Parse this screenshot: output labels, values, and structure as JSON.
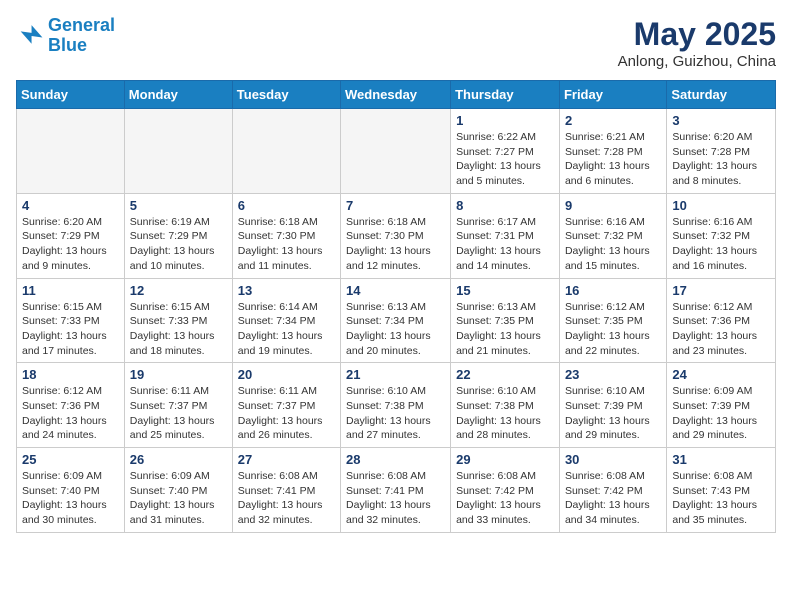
{
  "header": {
    "logo_line1": "General",
    "logo_line2": "Blue",
    "main_title": "May 2025",
    "sub_title": "Anlong, Guizhou, China"
  },
  "days_of_week": [
    "Sunday",
    "Monday",
    "Tuesday",
    "Wednesday",
    "Thursday",
    "Friday",
    "Saturday"
  ],
  "weeks": [
    [
      {
        "day": "",
        "info": ""
      },
      {
        "day": "",
        "info": ""
      },
      {
        "day": "",
        "info": ""
      },
      {
        "day": "",
        "info": ""
      },
      {
        "day": "1",
        "info": "Sunrise: 6:22 AM\nSunset: 7:27 PM\nDaylight: 13 hours and 5 minutes."
      },
      {
        "day": "2",
        "info": "Sunrise: 6:21 AM\nSunset: 7:28 PM\nDaylight: 13 hours and 6 minutes."
      },
      {
        "day": "3",
        "info": "Sunrise: 6:20 AM\nSunset: 7:28 PM\nDaylight: 13 hours and 8 minutes."
      }
    ],
    [
      {
        "day": "4",
        "info": "Sunrise: 6:20 AM\nSunset: 7:29 PM\nDaylight: 13 hours and 9 minutes."
      },
      {
        "day": "5",
        "info": "Sunrise: 6:19 AM\nSunset: 7:29 PM\nDaylight: 13 hours and 10 minutes."
      },
      {
        "day": "6",
        "info": "Sunrise: 6:18 AM\nSunset: 7:30 PM\nDaylight: 13 hours and 11 minutes."
      },
      {
        "day": "7",
        "info": "Sunrise: 6:18 AM\nSunset: 7:30 PM\nDaylight: 13 hours and 12 minutes."
      },
      {
        "day": "8",
        "info": "Sunrise: 6:17 AM\nSunset: 7:31 PM\nDaylight: 13 hours and 14 minutes."
      },
      {
        "day": "9",
        "info": "Sunrise: 6:16 AM\nSunset: 7:32 PM\nDaylight: 13 hours and 15 minutes."
      },
      {
        "day": "10",
        "info": "Sunrise: 6:16 AM\nSunset: 7:32 PM\nDaylight: 13 hours and 16 minutes."
      }
    ],
    [
      {
        "day": "11",
        "info": "Sunrise: 6:15 AM\nSunset: 7:33 PM\nDaylight: 13 hours and 17 minutes."
      },
      {
        "day": "12",
        "info": "Sunrise: 6:15 AM\nSunset: 7:33 PM\nDaylight: 13 hours and 18 minutes."
      },
      {
        "day": "13",
        "info": "Sunrise: 6:14 AM\nSunset: 7:34 PM\nDaylight: 13 hours and 19 minutes."
      },
      {
        "day": "14",
        "info": "Sunrise: 6:13 AM\nSunset: 7:34 PM\nDaylight: 13 hours and 20 minutes."
      },
      {
        "day": "15",
        "info": "Sunrise: 6:13 AM\nSunset: 7:35 PM\nDaylight: 13 hours and 21 minutes."
      },
      {
        "day": "16",
        "info": "Sunrise: 6:12 AM\nSunset: 7:35 PM\nDaylight: 13 hours and 22 minutes."
      },
      {
        "day": "17",
        "info": "Sunrise: 6:12 AM\nSunset: 7:36 PM\nDaylight: 13 hours and 23 minutes."
      }
    ],
    [
      {
        "day": "18",
        "info": "Sunrise: 6:12 AM\nSunset: 7:36 PM\nDaylight: 13 hours and 24 minutes."
      },
      {
        "day": "19",
        "info": "Sunrise: 6:11 AM\nSunset: 7:37 PM\nDaylight: 13 hours and 25 minutes."
      },
      {
        "day": "20",
        "info": "Sunrise: 6:11 AM\nSunset: 7:37 PM\nDaylight: 13 hours and 26 minutes."
      },
      {
        "day": "21",
        "info": "Sunrise: 6:10 AM\nSunset: 7:38 PM\nDaylight: 13 hours and 27 minutes."
      },
      {
        "day": "22",
        "info": "Sunrise: 6:10 AM\nSunset: 7:38 PM\nDaylight: 13 hours and 28 minutes."
      },
      {
        "day": "23",
        "info": "Sunrise: 6:10 AM\nSunset: 7:39 PM\nDaylight: 13 hours and 29 minutes."
      },
      {
        "day": "24",
        "info": "Sunrise: 6:09 AM\nSunset: 7:39 PM\nDaylight: 13 hours and 29 minutes."
      }
    ],
    [
      {
        "day": "25",
        "info": "Sunrise: 6:09 AM\nSunset: 7:40 PM\nDaylight: 13 hours and 30 minutes."
      },
      {
        "day": "26",
        "info": "Sunrise: 6:09 AM\nSunset: 7:40 PM\nDaylight: 13 hours and 31 minutes."
      },
      {
        "day": "27",
        "info": "Sunrise: 6:08 AM\nSunset: 7:41 PM\nDaylight: 13 hours and 32 minutes."
      },
      {
        "day": "28",
        "info": "Sunrise: 6:08 AM\nSunset: 7:41 PM\nDaylight: 13 hours and 32 minutes."
      },
      {
        "day": "29",
        "info": "Sunrise: 6:08 AM\nSunset: 7:42 PM\nDaylight: 13 hours and 33 minutes."
      },
      {
        "day": "30",
        "info": "Sunrise: 6:08 AM\nSunset: 7:42 PM\nDaylight: 13 hours and 34 minutes."
      },
      {
        "day": "31",
        "info": "Sunrise: 6:08 AM\nSunset: 7:43 PM\nDaylight: 13 hours and 35 minutes."
      }
    ]
  ]
}
